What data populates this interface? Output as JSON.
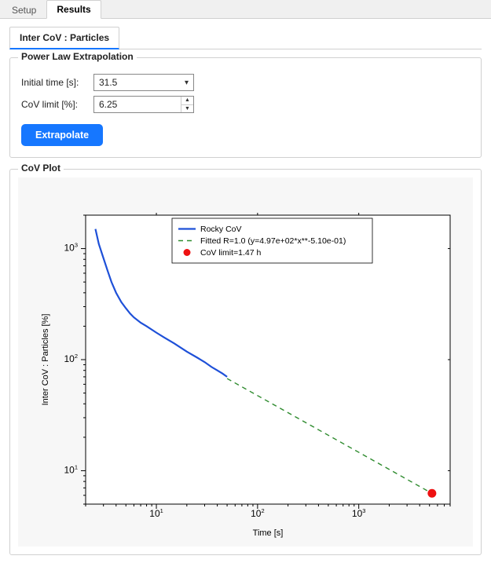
{
  "main_tabs": {
    "setup": "Setup",
    "results": "Results"
  },
  "sub_tabs": {
    "inter_cov": "Inter CoV : Particles"
  },
  "extrap_panel": {
    "title": "Power Law Extrapolation",
    "initial_time_label": "Initial time [s]:",
    "initial_time_value": "31.5",
    "cov_limit_label": "CoV limit [%]:",
    "cov_limit_value": "6.25",
    "button": "Extrapolate"
  },
  "plot_panel": {
    "title": "CoV Plot"
  },
  "chart_data": {
    "type": "line",
    "xlabel": "Time [s]",
    "ylabel": "Inter CoV : Particles [%]",
    "x_scale": "log",
    "y_scale": "log",
    "xlim": [
      2,
      8000
    ],
    "ylim": [
      5,
      2000
    ],
    "x_ticks_major": [
      10,
      100,
      1000
    ],
    "y_ticks_major": [
      10,
      100,
      1000
    ],
    "series": [
      {
        "name": "Rocky CoV",
        "style": "solid",
        "color": "#1e50d8",
        "x": [
          2.5,
          2.7,
          3.0,
          3.3,
          3.6,
          4.0,
          4.5,
          5.0,
          5.5,
          6.0,
          7.0,
          8.0,
          10,
          12,
          15,
          20,
          25,
          30,
          35,
          40,
          45,
          50
        ],
        "y": [
          1500,
          1100,
          820,
          630,
          500,
          400,
          330,
          290,
          260,
          240,
          215,
          200,
          175,
          158,
          140,
          118,
          105,
          95,
          86,
          80,
          75,
          70
        ]
      },
      {
        "name": "Fitted R=1.0 (y=4.97e+02*x**-5.10e-01)",
        "style": "dashed",
        "color": "#2e8b2e",
        "fit": {
          "a": 497,
          "b": -0.51
        },
        "x": [
          50,
          5290
        ],
        "y": [
          67.6,
          6.25
        ]
      }
    ],
    "annotations": [
      {
        "name": "CoV limit=1.47 h",
        "type": "point",
        "x": 5290,
        "y": 6.25,
        "color": "#ee1111"
      }
    ],
    "legend": {
      "position": "upper-right-inside",
      "entries": [
        "Rocky CoV",
        "Fitted R=1.0 (y=4.97e+02*x**-5.10e-01)",
        "CoV limit=1.47 h"
      ]
    }
  }
}
